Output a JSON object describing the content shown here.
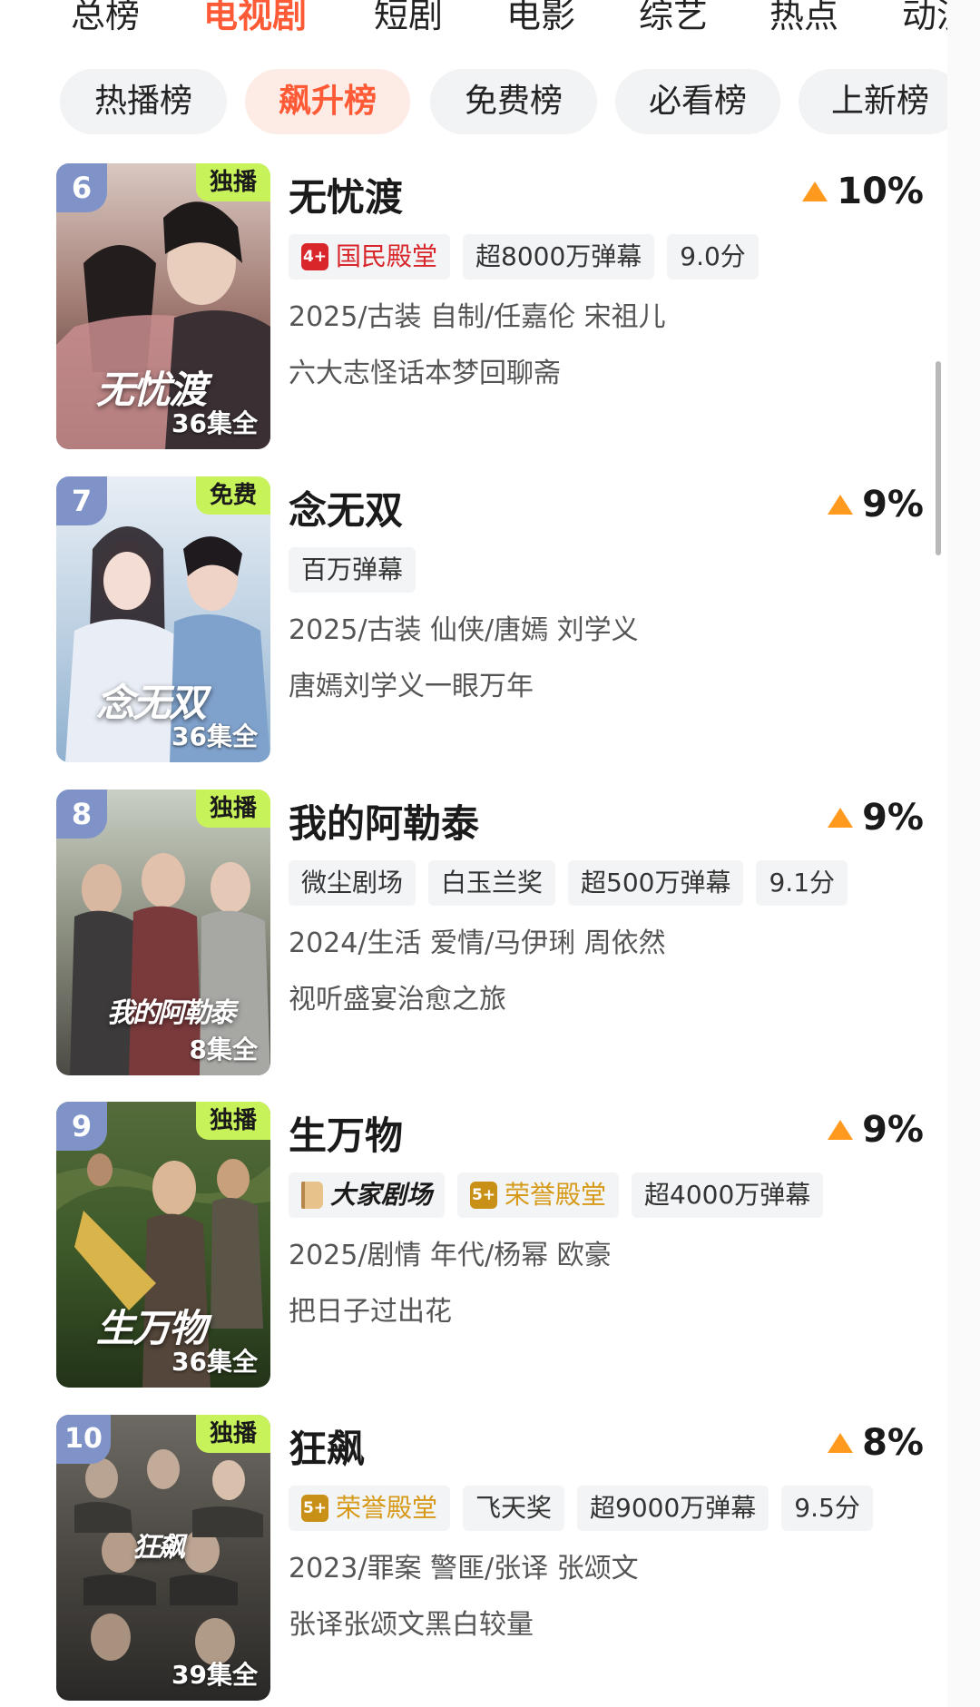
{
  "top_tabs": [
    "总榜",
    "电视剧",
    "短剧",
    "电影",
    "综艺",
    "热点",
    "动漫"
  ],
  "active_top_tab": "电视剧",
  "sub_tabs": [
    "热播榜",
    "飙升榜",
    "免费榜",
    "必看榜",
    "上新榜"
  ],
  "active_sub_tab": "飙升榜",
  "colors": {
    "accent": "#ff5a36",
    "rank_badge": "#7f93c9",
    "label_badge": "#c8f25a",
    "trend_up": "#ff9a1f",
    "tag_bg": "#f3f4f6"
  },
  "items": [
    {
      "rank": "6",
      "label": "独播",
      "episodes": "36集全",
      "poster_title": "无忧渡",
      "title": "无忧渡",
      "trend_icon": "trend-up-icon",
      "trend": "10%",
      "tags": [
        {
          "text": "国民殿堂",
          "style": "red",
          "icon": "4+"
        },
        {
          "text": "超8000万弹幕"
        },
        {
          "text": "9.0分"
        }
      ],
      "meta": "2025/古装 自制/任嘉伦 宋祖儿",
      "desc": "六大志怪话本梦回聊斋"
    },
    {
      "rank": "7",
      "label": "免费",
      "episodes": "36集全",
      "poster_title": "念无双",
      "title": "念无双",
      "trend_icon": "trend-up-icon",
      "trend": "9%",
      "tags": [
        {
          "text": "百万弹幕"
        }
      ],
      "meta": "2025/古装 仙侠/唐嫣 刘学义",
      "desc": "唐嫣刘学义一眼万年"
    },
    {
      "rank": "8",
      "label": "独播",
      "episodes": "8集全",
      "poster_title": "我的阿勒泰",
      "title": "我的阿勒泰",
      "trend_icon": "trend-up-icon",
      "trend": "9%",
      "tags": [
        {
          "text": "微尘剧场"
        },
        {
          "text": "白玉兰奖"
        },
        {
          "text": "超500万弹幕"
        },
        {
          "text": "9.1分"
        }
      ],
      "meta": "2024/生活 爱情/马伊琍 周依然",
      "desc": "视听盛宴治愈之旅"
    },
    {
      "rank": "9",
      "label": "独播",
      "episodes": "36集全",
      "poster_title": "生万物",
      "title": "生万物",
      "trend_icon": "trend-up-icon",
      "trend": "9%",
      "tags": [
        {
          "text": "大家剧场",
          "style": "brand",
          "icon": "book"
        },
        {
          "text": "荣誉殿堂",
          "style": "gold",
          "icon": "5+"
        },
        {
          "text": "超4000万弹幕"
        }
      ],
      "meta": "2025/剧情 年代/杨幂 欧豪",
      "desc": "把日子过出花"
    },
    {
      "rank": "10",
      "label": "独播",
      "episodes": "39集全",
      "poster_title": "狂飙",
      "title": "狂飙",
      "trend_icon": "trend-up-icon",
      "trend": "8%",
      "tags": [
        {
          "text": "荣誉殿堂",
          "style": "gold",
          "icon": "5+"
        },
        {
          "text": "飞天奖"
        },
        {
          "text": "超9000万弹幕"
        },
        {
          "text": "9.5分"
        }
      ],
      "meta": "2023/罪案 警匪/张译 张颂文",
      "desc": "张译张颂文黑白较量"
    }
  ]
}
